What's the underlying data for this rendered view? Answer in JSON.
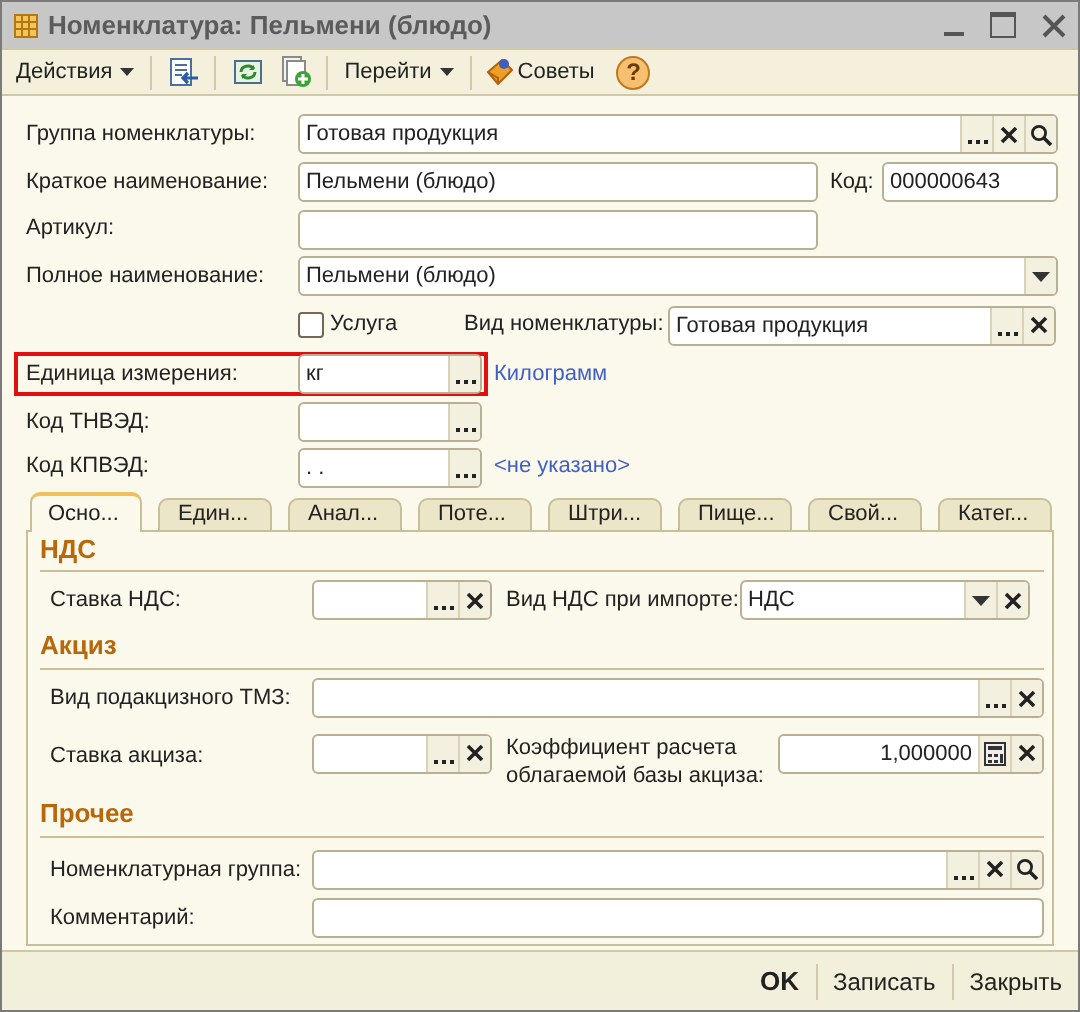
{
  "window": {
    "title": "Номенклатура: Пельмени (блюдо)"
  },
  "toolbar": {
    "actions": "Действия",
    "goto": "Перейти",
    "tips": "Советы",
    "help": "?"
  },
  "form": {
    "group": {
      "label": "Группа номенклатуры:",
      "value": "Готовая продукция"
    },
    "short_name": {
      "label": "Краткое наименование:",
      "value": "Пельмени (блюдо)"
    },
    "code": {
      "label": "Код:",
      "value": "000000643"
    },
    "article": {
      "label": "Артикул:"
    },
    "full_name": {
      "label": "Полное наименование:",
      "value": "Пельмени (блюдо)"
    },
    "service": {
      "label": "Услуга",
      "checked": false
    },
    "item_type": {
      "label": "Вид номенклатуры:",
      "value": "Готовая продукция"
    },
    "unit": {
      "label": "Единица измерения:",
      "value": "кг",
      "link": "Килограмм",
      "highlighted": true
    },
    "tnved": {
      "label": "Код ТНВЭД:"
    },
    "kpved": {
      "label": "Код КПВЭД:",
      "value": ". .",
      "link": "<не указано>"
    }
  },
  "tabs": [
    {
      "label": "Осно...",
      "selected": true
    },
    {
      "label": "Един...",
      "selected": false
    },
    {
      "label": "Анал...",
      "selected": false
    },
    {
      "label": "Поте...",
      "selected": false
    },
    {
      "label": "Штри...",
      "selected": false
    },
    {
      "label": "Пище...",
      "selected": false
    },
    {
      "label": "Свой...",
      "selected": false
    },
    {
      "label": "Катег...",
      "selected": false
    }
  ],
  "vat": {
    "heading": "НДС",
    "rate": {
      "label": "Ставка НДС:"
    },
    "import_type": {
      "label": "Вид НДС при импорте:",
      "value": "НДС"
    }
  },
  "excise": {
    "heading": "Акциз",
    "tmz_type": {
      "label": "Вид подакцизного ТМЗ:"
    },
    "rate": {
      "label": "Ставка акциза:"
    },
    "base_coefficient": {
      "label": "Коэффициент расчета облагаемой базы акциза:",
      "value": "1,000000"
    }
  },
  "other": {
    "heading": "Прочее",
    "item_group": {
      "label": "Номенклатурная группа:"
    },
    "comment": {
      "label": "Комментарий:"
    }
  },
  "buttons": [
    {
      "label": "OK",
      "default": true
    },
    {
      "label": "Записать",
      "default": false
    },
    {
      "label": "Закрыть",
      "default": false
    }
  ]
}
